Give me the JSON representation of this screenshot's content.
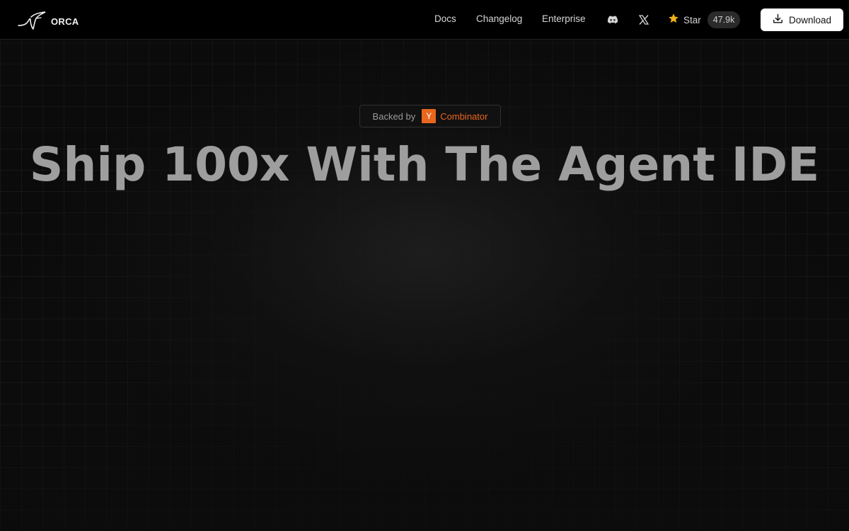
{
  "brand": {
    "name": "ORCA",
    "logo_icon": "orca-logo-icon"
  },
  "nav": {
    "docs": "Docs",
    "changelog": "Changelog",
    "enterprise": "Enterprise",
    "discord_icon": "discord-icon",
    "x_icon": "x-twitter-icon"
  },
  "github": {
    "star_label": "Star",
    "star_count": "47.9k",
    "star_icon": "star-icon"
  },
  "download": {
    "label": "Download",
    "icon": "download-icon"
  },
  "hero": {
    "badge_prefix": "Backed by",
    "badge_logo_letter": "Y",
    "badge_brand": "Combinator",
    "title": "Ship 100x With The Agent IDE"
  },
  "colors": {
    "background": "#0b0b0b",
    "accent_orange": "#e8661e",
    "star_yellow": "#f2b01e",
    "title_gray": "#9e9e9e"
  }
}
